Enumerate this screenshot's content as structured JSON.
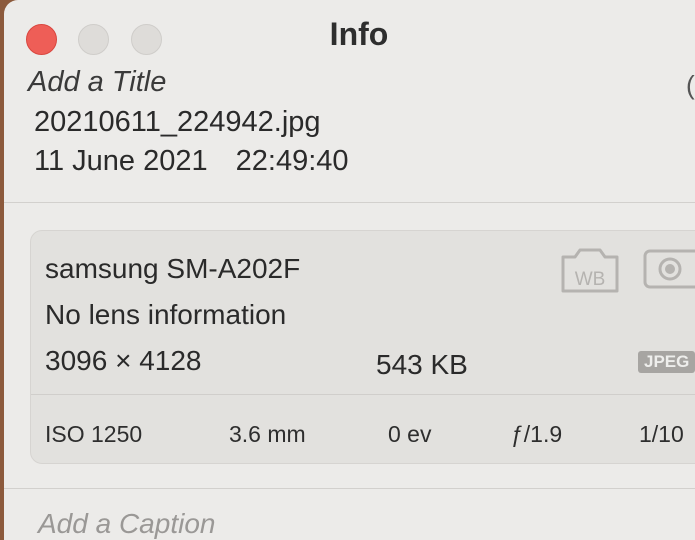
{
  "window": {
    "title": "Info"
  },
  "header": {
    "title_placeholder": "Add a Title",
    "filename": "20210611_224942.jpg",
    "date": "11 June 2021",
    "time": "22:49:40",
    "edge_glyph": "("
  },
  "camera": {
    "model": "samsung SM-A202F",
    "lens": "No lens information",
    "dimensions": "3096 × 4128",
    "file_size": "543 KB",
    "format_badge": "JPEG",
    "wb_icon_label": "WB"
  },
  "exif": {
    "iso": "ISO 1250",
    "focal_length": "3.6 mm",
    "exposure_bias": "0 ev",
    "aperture": "ƒ/1.9",
    "shutter": "1/10"
  },
  "caption": {
    "placeholder": "Add a Caption"
  },
  "icons": {
    "close": "close-button",
    "minimize": "minimize-button",
    "maximize": "maximize-button",
    "white_balance": "camera-wb-icon",
    "live_photo": "live-photo-icon"
  },
  "colors": {
    "close": "#ee5e57",
    "window_bg": "#ecebe9",
    "card_bg": "#e2e1de",
    "desktop": "#8c5a3c"
  }
}
